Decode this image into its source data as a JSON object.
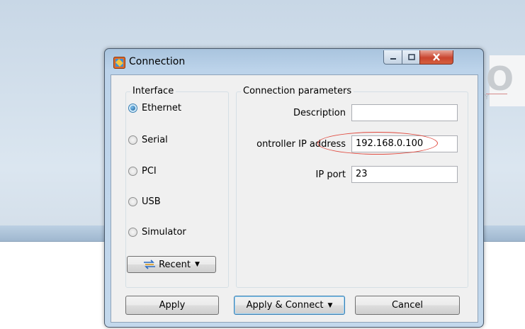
{
  "window": {
    "title": "Connection",
    "icon": "app-icon"
  },
  "controls": {
    "minimize": "minimize-icon",
    "maximize": "maximize-icon",
    "close": "close-icon"
  },
  "interface": {
    "legend": "Interface",
    "options": [
      {
        "label": "Ethernet",
        "selected": true
      },
      {
        "label": "Serial",
        "selected": false
      },
      {
        "label": "PCI",
        "selected": false
      },
      {
        "label": "USB",
        "selected": false
      },
      {
        "label": "Simulator",
        "selected": false
      }
    ],
    "recent_label": "Recent",
    "recent_icon": "recent-icon"
  },
  "params": {
    "legend": "Connection parameters",
    "description_label": "Description",
    "description_value": "",
    "ip_label": "ontroller IP address",
    "ip_value": "192.168.0.100",
    "port_label": "IP port",
    "port_value": "23"
  },
  "buttons": {
    "apply": "Apply",
    "apply_connect": "Apply & Connect",
    "cancel": "Cancel"
  },
  "annotation_color": "#e0473c"
}
